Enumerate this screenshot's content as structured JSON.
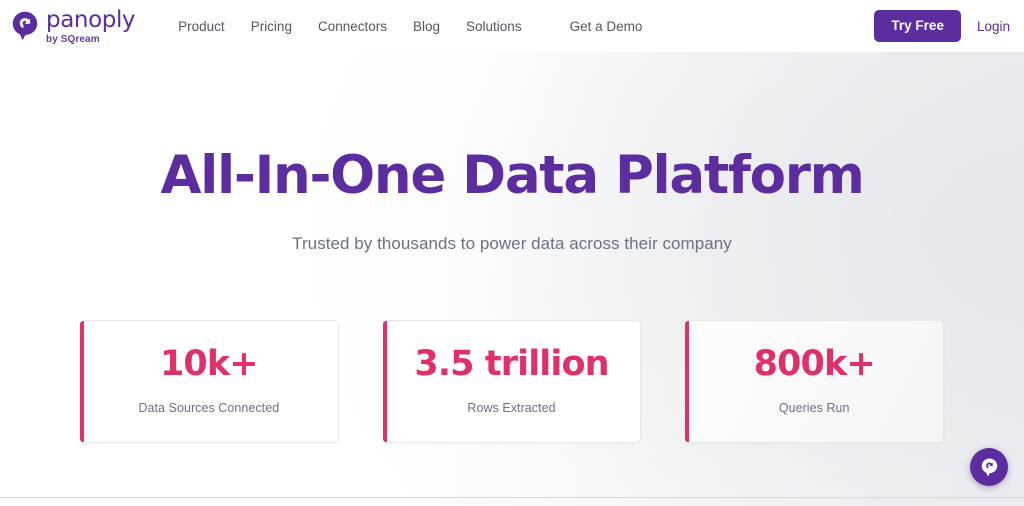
{
  "header": {
    "brand": {
      "name": "panoply",
      "sub": "by SQream",
      "logo_icon": "panoply-droplet-logo-icon",
      "color": "#5b2d9e"
    },
    "nav": [
      {
        "label": "Product"
      },
      {
        "label": "Pricing"
      },
      {
        "label": "Connectors"
      },
      {
        "label": "Blog"
      },
      {
        "label": "Solutions"
      },
      {
        "label": "Get a Demo"
      }
    ],
    "try_free_label": "Try Free",
    "login_label": "Login",
    "try_free_bg": "#5b2d9e"
  },
  "hero": {
    "title": "All-In-One Data Platform",
    "subtitle": "Trusted by thousands to power data across their company",
    "title_color": "#5b2d9e",
    "subtitle_color": "#6b7280"
  },
  "stats": {
    "accent_color": "#e0306a",
    "cards": [
      {
        "value": "10k+",
        "label": "Data Sources Connected"
      },
      {
        "value": "3.5 trillion",
        "label": "Rows Extracted"
      },
      {
        "value": "800k+",
        "label": "Queries Run"
      }
    ]
  },
  "chat_widget": {
    "icon": "panoply-droplet-logo-icon",
    "bg": "#5b2d9e"
  }
}
